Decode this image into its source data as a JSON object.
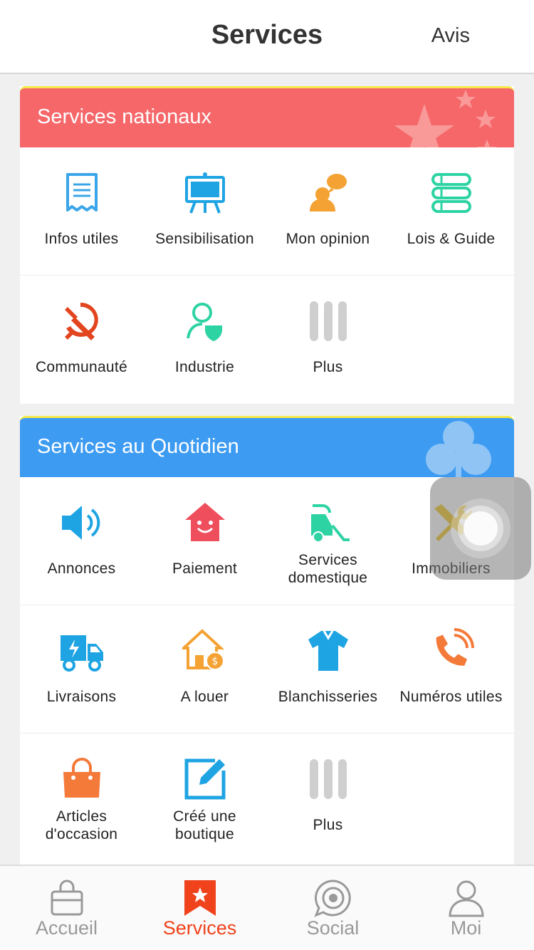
{
  "header": {
    "title": "Services",
    "right_action": "Avis"
  },
  "colors": {
    "national_header": "#f6676a",
    "daily_header": "#3d9bf2",
    "accent": "#f0431c",
    "inactive": "#999999"
  },
  "national": {
    "title": "Services nationaux",
    "items": [
      {
        "label": "Infos utiles",
        "icon": "document-icon"
      },
      {
        "label": "Sensibilisation",
        "icon": "easel-board-icon"
      },
      {
        "label": "Mon opinion",
        "icon": "speech-person-icon"
      },
      {
        "label": "Lois & Guide",
        "icon": "books-stack-icon"
      },
      {
        "label": "Communauté",
        "icon": "hammer-sickle-icon"
      },
      {
        "label": "Industrie",
        "icon": "person-shield-icon"
      },
      {
        "label": "Plus",
        "icon": "more-bars-icon"
      }
    ]
  },
  "daily": {
    "title": "Services au Quotidien",
    "items": [
      {
        "label": "Annonces",
        "icon": "speaker-icon"
      },
      {
        "label": "Paiement",
        "icon": "smiling-house-icon"
      },
      {
        "label": "Services\ndomestique",
        "icon": "vacuum-cleaner-icon"
      },
      {
        "label": "Immobiliers",
        "icon": "tools-icon"
      },
      {
        "label": "Livraisons",
        "icon": "delivery-truck-icon"
      },
      {
        "label": "A louer",
        "icon": "house-coin-icon"
      },
      {
        "label": "Blanchisseries",
        "icon": "shirt-icon"
      },
      {
        "label": "Numéros utiles",
        "icon": "phone-icon"
      },
      {
        "label": "Articles\nd'occasion",
        "icon": "handbag-icon"
      },
      {
        "label": "Créé une\nboutique",
        "icon": "edit-icon"
      },
      {
        "label": "Plus",
        "icon": "more-bars-icon"
      }
    ]
  },
  "tabs": [
    {
      "label": "Accueil",
      "icon": "shopping-bag-icon",
      "active": false
    },
    {
      "label": "Services",
      "icon": "bookmark-star-icon",
      "active": true
    },
    {
      "label": "Social",
      "icon": "chat-target-icon",
      "active": false
    },
    {
      "label": "Moi",
      "icon": "user-icon",
      "active": false
    }
  ]
}
